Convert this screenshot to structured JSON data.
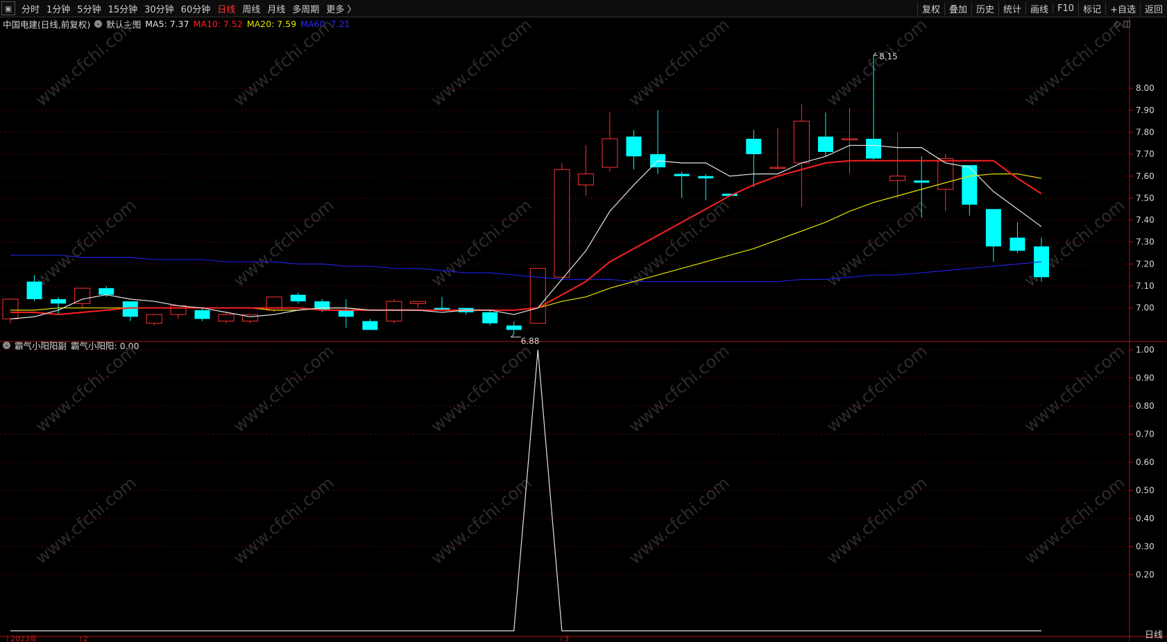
{
  "toolbar": {
    "left_items": [
      "分时",
      "1分钟",
      "5分钟",
      "15分钟",
      "30分钟",
      "60分钟",
      "日线",
      "周线",
      "月线",
      "多周期",
      "更多 〉"
    ],
    "active": "日线",
    "right_items": [
      "复权",
      "叠加",
      "历史",
      "统计",
      "画线",
      "F10",
      "标记",
      "+自选",
      "返回"
    ]
  },
  "main_legend": {
    "stock": "中国电建(日线,前复权)",
    "template": "默认主图",
    "ma5": "MA5: 7.37",
    "ma10": "MA10: 7.52",
    "ma20": "MA20: 7.59",
    "ma60": "MA60: 7.21"
  },
  "sub_legend": {
    "indicator": "霸气小阳阳副",
    "value": "霸气小阳阳: 0.00"
  },
  "annotations": {
    "high": "8.15",
    "low": "6.88"
  },
  "x_labels": [
    "2023年",
    "2",
    "3"
  ],
  "status_text": "日线",
  "watermark": "www.cfchi.com",
  "colors": {
    "up": "#ff3232",
    "down": "#00ffff",
    "ma5": "#e6e6e6",
    "ma10": "#ff2020",
    "ma20": "#e6e600",
    "ma60": "#1e1edc",
    "axis": "#b41414"
  },
  "chart_data": [
    {
      "type": "candlestick",
      "title": "中国电建(日线,前复权)",
      "ylim": [
        6.86,
        8.25
      ],
      "yticks": [
        7.0,
        7.1,
        7.2,
        7.3,
        7.4,
        7.5,
        7.6,
        7.7,
        7.8,
        7.9,
        8.0
      ],
      "candles": [
        {
          "o": 6.95,
          "h": 7.04,
          "l": 6.93,
          "c": 7.04
        },
        {
          "o": 7.12,
          "h": 7.15,
          "l": 7.03,
          "c": 7.04
        },
        {
          "o": 7.04,
          "h": 7.05,
          "l": 6.97,
          "c": 7.02
        },
        {
          "o": 7.02,
          "h": 7.09,
          "l": 7.0,
          "c": 7.09
        },
        {
          "o": 7.09,
          "h": 7.1,
          "l": 7.05,
          "c": 7.06
        },
        {
          "o": 7.03,
          "h": 7.03,
          "l": 6.94,
          "c": 6.96
        },
        {
          "o": 6.93,
          "h": 6.97,
          "l": 6.92,
          "c": 6.97
        },
        {
          "o": 6.97,
          "h": 7.01,
          "l": 6.95,
          "c": 7.01
        },
        {
          "o": 6.99,
          "h": 7.0,
          "l": 6.94,
          "c": 6.95
        },
        {
          "o": 6.94,
          "h": 6.98,
          "l": 6.93,
          "c": 6.97
        },
        {
          "o": 6.94,
          "h": 6.97,
          "l": 6.93,
          "c": 6.97
        },
        {
          "o": 6.99,
          "h": 7.05,
          "l": 6.98,
          "c": 7.05
        },
        {
          "o": 7.06,
          "h": 7.07,
          "l": 7.02,
          "c": 7.03
        },
        {
          "o": 7.03,
          "h": 7.04,
          "l": 6.98,
          "c": 6.99
        },
        {
          "o": 6.99,
          "h": 7.04,
          "l": 6.91,
          "c": 6.96
        },
        {
          "o": 6.94,
          "h": 6.95,
          "l": 6.9,
          "c": 6.9
        },
        {
          "o": 6.94,
          "h": 7.04,
          "l": 6.93,
          "c": 7.03
        },
        {
          "o": 7.02,
          "h": 7.03,
          "l": 7.0,
          "c": 7.03
        },
        {
          "o": 7.0,
          "h": 7.05,
          "l": 6.99,
          "c": 6.99
        },
        {
          "o": 7.0,
          "h": 7.0,
          "l": 6.97,
          "c": 6.98
        },
        {
          "o": 6.98,
          "h": 6.99,
          "l": 6.92,
          "c": 6.93
        },
        {
          "o": 6.92,
          "h": 6.94,
          "l": 6.88,
          "c": 6.9
        },
        {
          "o": 6.93,
          "h": 7.18,
          "l": 6.93,
          "c": 7.18
        },
        {
          "o": 7.14,
          "h": 7.66,
          "l": 7.14,
          "c": 7.63
        },
        {
          "o": 7.56,
          "h": 7.74,
          "l": 7.51,
          "c": 7.61
        },
        {
          "o": 7.64,
          "h": 7.89,
          "l": 7.62,
          "c": 7.77
        },
        {
          "o": 7.78,
          "h": 7.81,
          "l": 7.63,
          "c": 7.69
        },
        {
          "o": 7.7,
          "h": 7.9,
          "l": 7.61,
          "c": 7.64
        },
        {
          "o": 7.61,
          "h": 7.62,
          "l": 7.5,
          "c": 7.6
        },
        {
          "o": 7.6,
          "h": 7.61,
          "l": 7.49,
          "c": 7.59
        },
        {
          "o": 7.52,
          "h": 7.52,
          "l": 7.51,
          "c": 7.51
        },
        {
          "o": 7.77,
          "h": 7.81,
          "l": 7.55,
          "c": 7.7
        },
        {
          "o": 7.64,
          "h": 7.82,
          "l": 7.63,
          "c": 7.64
        },
        {
          "o": 7.66,
          "h": 7.93,
          "l": 7.46,
          "c": 7.85
        },
        {
          "o": 7.78,
          "h": 7.89,
          "l": 7.69,
          "c": 7.71
        },
        {
          "o": 7.77,
          "h": 7.91,
          "l": 7.61,
          "c": 7.77
        },
        {
          "o": 7.77,
          "h": 8.15,
          "l": 7.67,
          "c": 7.68
        },
        {
          "o": 7.58,
          "h": 7.8,
          "l": 7.5,
          "c": 7.6
        },
        {
          "o": 7.58,
          "h": 7.69,
          "l": 7.41,
          "c": 7.57
        },
        {
          "o": 7.54,
          "h": 7.7,
          "l": 7.44,
          "c": 7.68
        },
        {
          "o": 7.65,
          "h": 7.65,
          "l": 7.42,
          "c": 7.47
        },
        {
          "o": 7.45,
          "h": 7.45,
          "l": 7.21,
          "c": 7.28
        },
        {
          "o": 7.32,
          "h": 7.39,
          "l": 7.25,
          "c": 7.26
        },
        {
          "o": 7.28,
          "h": 7.32,
          "l": 7.12,
          "c": 7.14
        }
      ],
      "ma5": [
        6.95,
        6.96,
        6.99,
        7.04,
        7.06,
        7.04,
        7.03,
        7.01,
        7.0,
        6.98,
        6.96,
        6.97,
        6.99,
        7.0,
        7.0,
        6.99,
        6.99,
        6.99,
        6.98,
        6.99,
        6.99,
        6.97,
        7.0,
        7.13,
        7.26,
        7.44,
        7.56,
        7.67,
        7.66,
        7.66,
        7.6,
        7.61,
        7.61,
        7.66,
        7.69,
        7.74,
        7.74,
        7.73,
        7.73,
        7.66,
        7.64,
        7.53,
        7.45,
        7.37
      ],
      "ma10": [
        6.98,
        6.98,
        6.97,
        6.98,
        6.99,
        7.0,
        7.0,
        7.0,
        7.0,
        7.0,
        7.0,
        7.0,
        7.0,
        6.99,
        6.99,
        6.99,
        6.99,
        6.99,
        6.99,
        6.99,
        6.99,
        6.99,
        7.0,
        7.06,
        7.12,
        7.21,
        7.27,
        7.33,
        7.39,
        7.45,
        7.51,
        7.56,
        7.6,
        7.63,
        7.66,
        7.67,
        7.67,
        7.67,
        7.67,
        7.67,
        7.67,
        7.67,
        7.59,
        7.52
      ],
      "ma20": [
        6.99,
        6.99,
        7.0,
        7.0,
        7.0,
        7.0,
        7.0,
        7.0,
        7.0,
        7.0,
        7.0,
        6.99,
        6.99,
        7.0,
        7.0,
        6.99,
        6.99,
        6.99,
        6.99,
        6.99,
        6.99,
        6.99,
        7.0,
        7.03,
        7.05,
        7.09,
        7.12,
        7.15,
        7.18,
        7.21,
        7.24,
        7.27,
        7.31,
        7.35,
        7.39,
        7.44,
        7.48,
        7.51,
        7.54,
        7.57,
        7.6,
        7.61,
        7.61,
        7.59
      ],
      "ma60": [
        7.24,
        7.24,
        7.24,
        7.23,
        7.23,
        7.23,
        7.22,
        7.22,
        7.22,
        7.21,
        7.21,
        7.21,
        7.2,
        7.2,
        7.19,
        7.19,
        7.18,
        7.18,
        7.17,
        7.16,
        7.16,
        7.15,
        7.14,
        7.13,
        7.13,
        7.13,
        7.12,
        7.12,
        7.12,
        7.12,
        7.12,
        7.12,
        7.12,
        7.13,
        7.13,
        7.14,
        7.15,
        7.15,
        7.16,
        7.17,
        7.18,
        7.19,
        7.2,
        7.21
      ]
    },
    {
      "type": "line",
      "title": "霸气小阳阳副",
      "ylim": [
        -0.02,
        1.02
      ],
      "yticks": [
        0.2,
        0.3,
        0.4,
        0.5,
        0.6,
        0.7,
        0.8,
        0.9,
        1.0
      ],
      "series": [
        {
          "name": "霸气小阳阳",
          "values": [
            0,
            0,
            0,
            0,
            0,
            0,
            0,
            0,
            0,
            0,
            0,
            0,
            0,
            0,
            0,
            0,
            0,
            0,
            0,
            0,
            0,
            0,
            1,
            0,
            0,
            0,
            0,
            0,
            0,
            0,
            0,
            0,
            0,
            0,
            0,
            0,
            0,
            0,
            0,
            0,
            0,
            0,
            0,
            0
          ]
        }
      ]
    }
  ]
}
